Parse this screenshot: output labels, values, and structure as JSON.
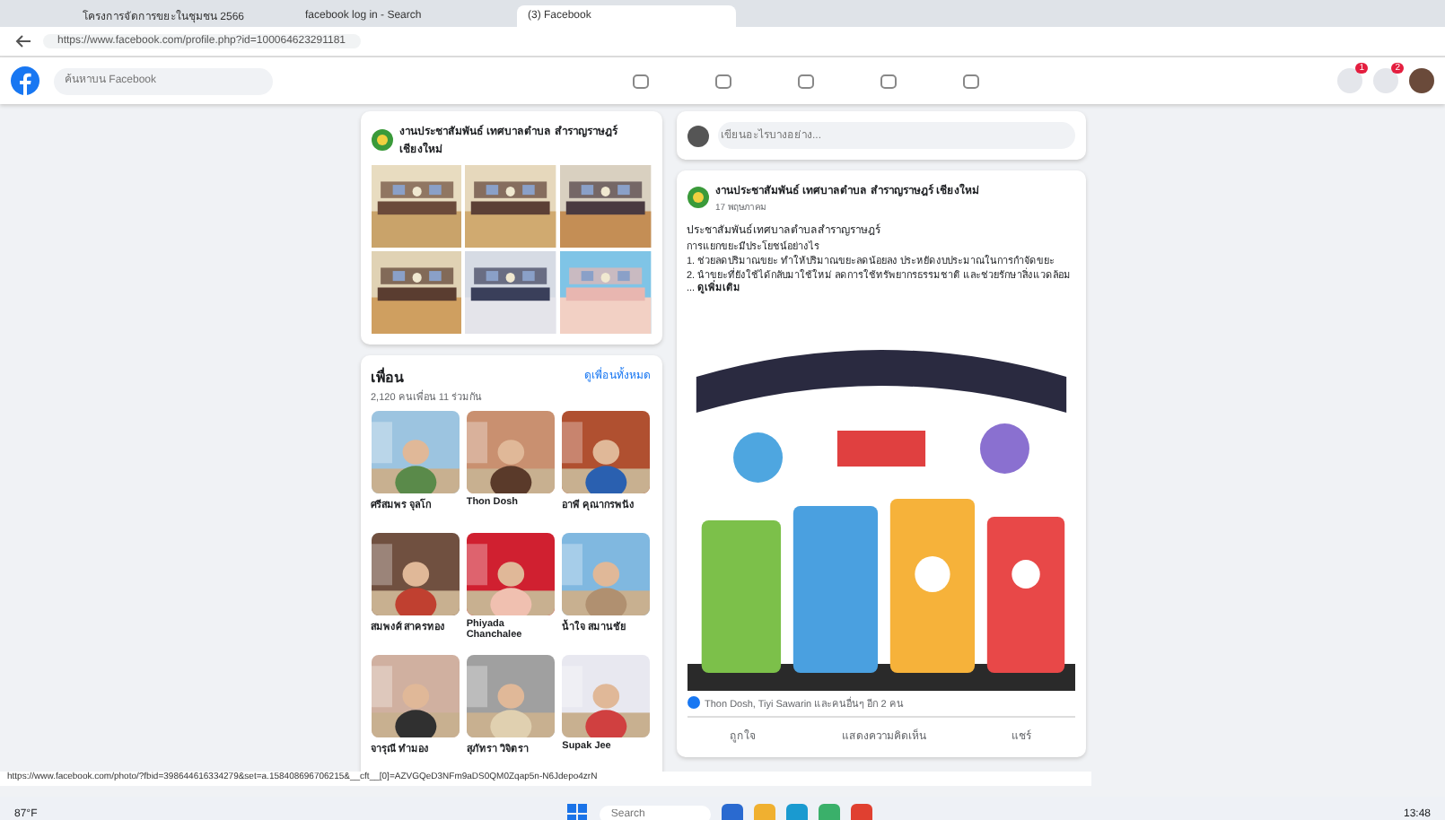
{
  "browser": {
    "tabs": [
      {
        "label": "โครงการจัดการขยะในชุมชน 2566",
        "selected": false
      },
      {
        "label": "facebook log in - Search",
        "selected": false
      },
      {
        "label": "(3) Facebook",
        "selected": true
      }
    ],
    "url": "https://www.facebook.com/profile.php?id=100064623291181"
  },
  "header": {
    "search": {
      "placeholder": "ค้นหาบน Facebook"
    },
    "notification_badges": [
      "1",
      "2"
    ]
  },
  "page_card": {
    "page_name": "งานประชาสัมพันธ์ เทศบาลตำบล สำราญราษฎร์ เชียงใหม่"
  },
  "friends": {
    "title": "เพื่อน",
    "see_all": "ดูเพื่อนทั้งหมด",
    "count": "2,120 คนเพื่อน 11 ร่วมกัน",
    "items": [
      {
        "name": "ศรีสมพร จุลโก"
      },
      {
        "name": "Thon Dosh"
      },
      {
        "name": "อาพี คุณากรพนัง"
      },
      {
        "name": "สมพงศ์ สาครทอง"
      },
      {
        "name": "Phiyada Chanchalee"
      },
      {
        "name": "น้ำใจ สมานชัย"
      },
      {
        "name": "จารุณี ทำมอง"
      },
      {
        "name": "สุภัทรา วิจิตรา"
      },
      {
        "name": "Supak Jee"
      }
    ]
  },
  "composer": {
    "placeholder": "เขียนอะไรบางอย่าง..."
  },
  "post": {
    "author": "งานประชาสัมพันธ์ เทศบาลตำบล สำราญราษฎร์ เชียงใหม่",
    "time": "17 พฤษภาคม",
    "title": "ประชาสัมพันธ์เทศบาลตำบลสำราญราษฎร์",
    "paragraphs": [
      "การแยกขยะมีประโยชน์อย่างไร",
      "1. ช่วยลดปริมาณขยะ ทำให้ปริมาณขยะลดน้อยลง ประหยัดงบประมาณในการกำจัดขยะ",
      "2. นำขยะที่ยังใช้ได้กลับมาใช้ใหม่ ลดการใช้ทรัพยากรธรรมชาติ และช่วยรักษาสิ่งแวดล้อม ... **ดูเพิ่มเติม**"
    ],
    "reactions": "Thon Dosh, Tiyi Sawarin และคนอื่นๆ อีก 2 คน",
    "actions": [
      "ถูกใจ",
      "แสดงความคิดเห็น",
      "แชร์"
    ]
  },
  "status_url": "https://www.facebook.com/photo/?fbid=398644616334279&set=a.158408696706215&__cft__[0]=AZVGQeD3NFm9aDS0QM0Zqap5n-N6Jdepo4zrN",
  "taskbar": {
    "weather": "87°F",
    "search": {
      "placeholder": "Search"
    },
    "time": "13:48"
  }
}
